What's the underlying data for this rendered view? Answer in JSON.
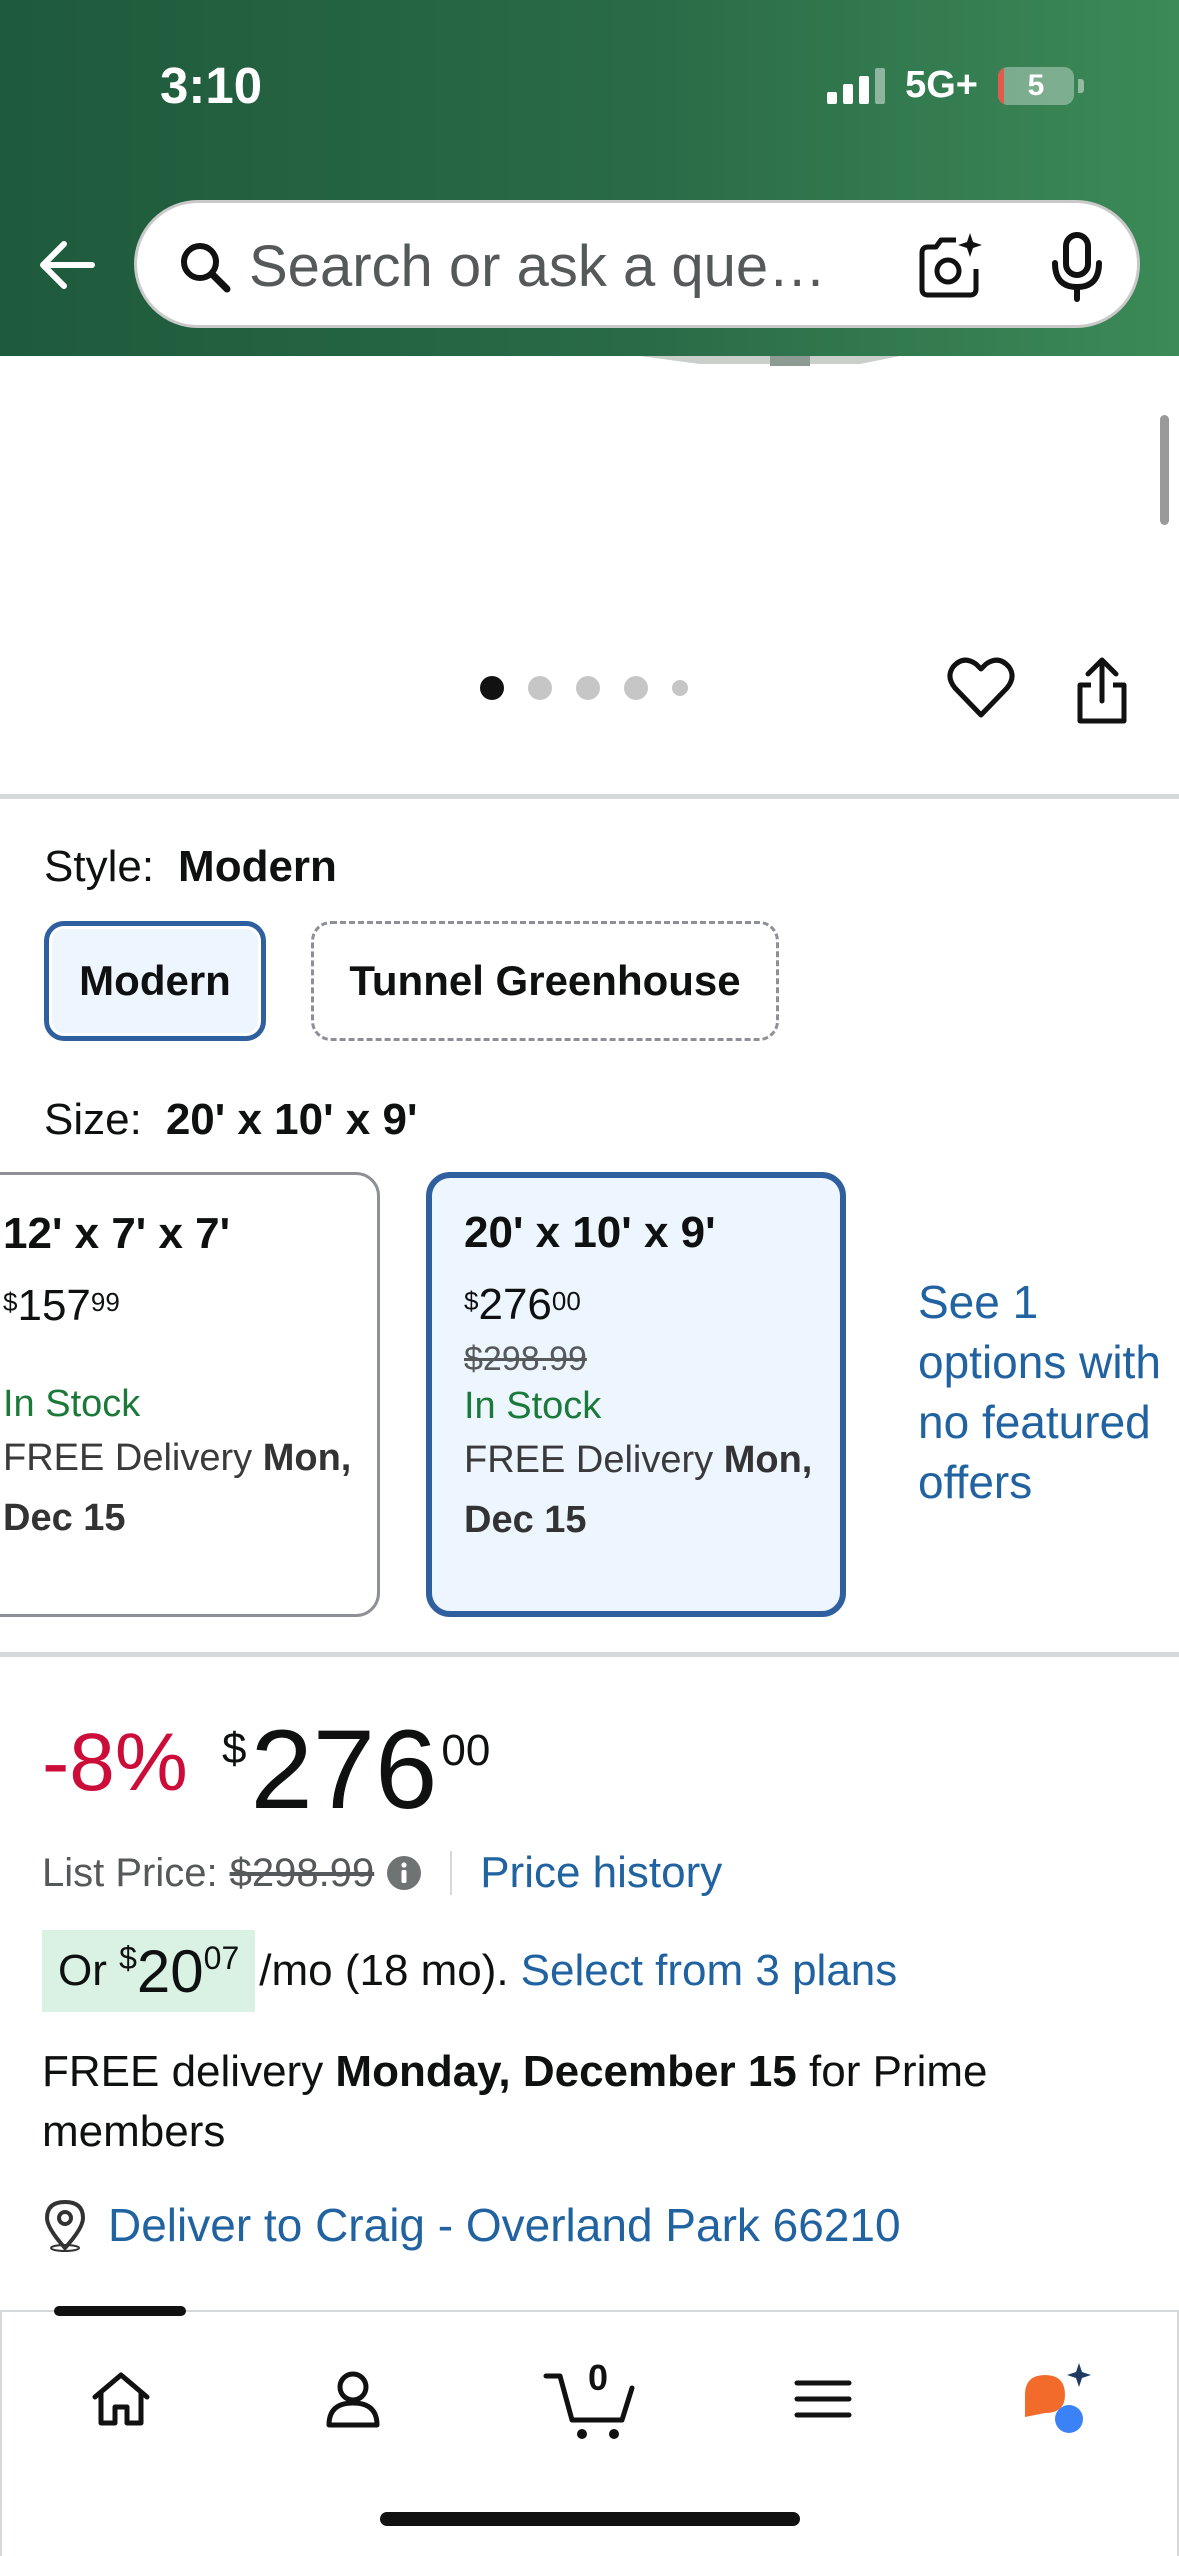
{
  "status_bar": {
    "time": "3:10",
    "network": "5G+",
    "battery": "5",
    "battery_level_percent": 5
  },
  "search": {
    "placeholder": "Search or ask a que…"
  },
  "gallery": {
    "total_images": 5,
    "active_index": 0
  },
  "style": {
    "label": "Style:",
    "selected": "Modern",
    "options": [
      "Modern",
      "Tunnel Greenhouse"
    ]
  },
  "size": {
    "label": "Size:",
    "selected": "20' x 10' x 9'",
    "options": [
      {
        "title": "12' x 7' x 7'",
        "price_symbol": "$",
        "price_whole": "157",
        "price_cents": "99",
        "list_price": "",
        "stock": "In Stock",
        "delivery_prefix": "FREE Delivery ",
        "delivery_date": "Mon, Dec 15"
      },
      {
        "title": "20' x 10' x 9'",
        "price_symbol": "$",
        "price_whole": "276",
        "price_cents": "00",
        "list_price": "$298.99",
        "stock": "In Stock",
        "delivery_prefix": "FREE Delivery ",
        "delivery_date": "Mon, Dec 15"
      }
    ],
    "see_more": "See 1 options with no featured offers"
  },
  "pricing": {
    "discount": "-8%",
    "symbol": "$",
    "whole": "276",
    "cents": "00",
    "list_price_label": "List Price:",
    "list_price": "$298.99",
    "price_history": "Price history",
    "monthly_prefix": "Or ",
    "monthly_symbol": "$",
    "monthly_whole": "20",
    "monthly_cents": "07",
    "monthly_suffix": "/mo (18 mo).",
    "monthly_plans": "Select from 3 plans"
  },
  "delivery": {
    "prefix": "FREE delivery ",
    "date": "Monday, December 15",
    "suffix": " for Prime members",
    "deliver_to": "Deliver to Craig - Overland Park 66210"
  },
  "nav": {
    "cart_count": "0",
    "items": [
      "home-icon",
      "account-icon",
      "cart-icon",
      "menu-icon",
      "rufus-icon"
    ]
  },
  "colors": {
    "header_green": "#2a6b47",
    "link_blue": "#2162a1",
    "discount_red": "#cc0c39",
    "in_stock_green": "#1b7a3a",
    "selected_border": "#2f5f9f"
  }
}
